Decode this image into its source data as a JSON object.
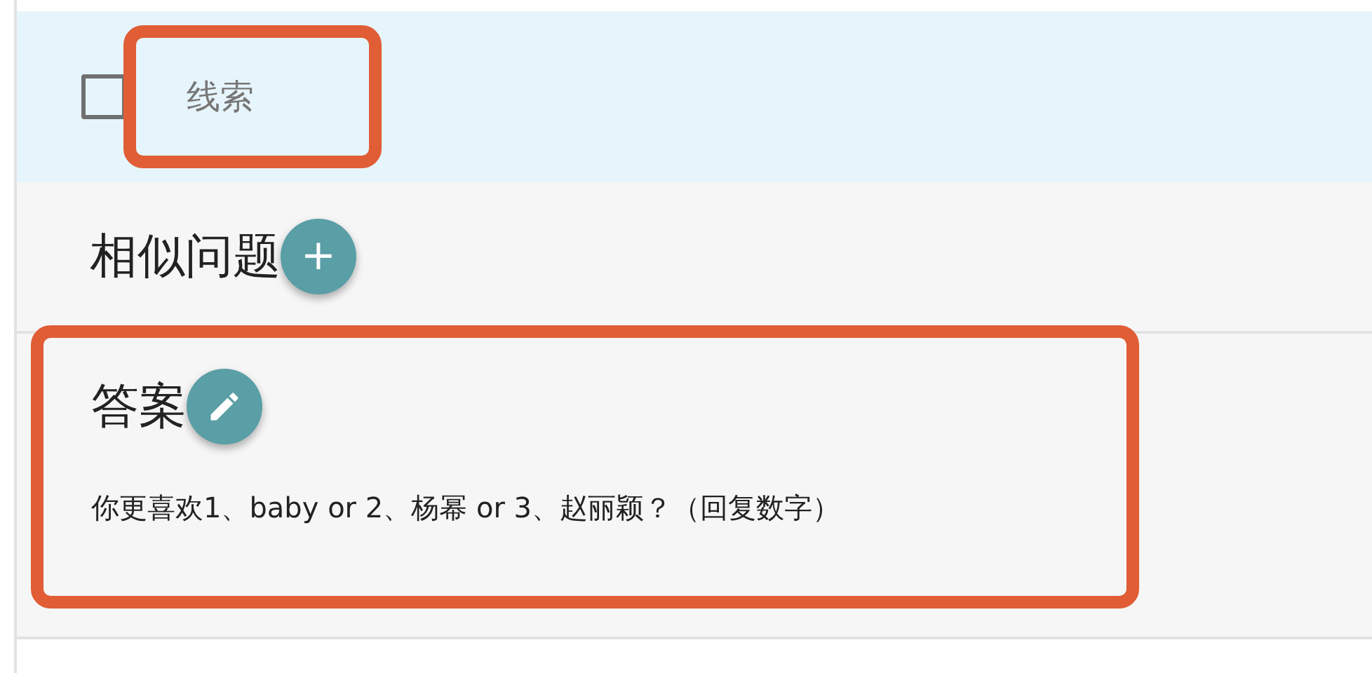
{
  "clue_row": {
    "checked": false,
    "label": "线索",
    "highlighted": true
  },
  "similar_questions": {
    "title": "相似问题",
    "button": "+"
  },
  "answer": {
    "title": "答案",
    "text": "你更喜欢1、baby or 2、杨幂 or 3、赵丽颖？（回复数字）",
    "highlighted": true
  }
}
